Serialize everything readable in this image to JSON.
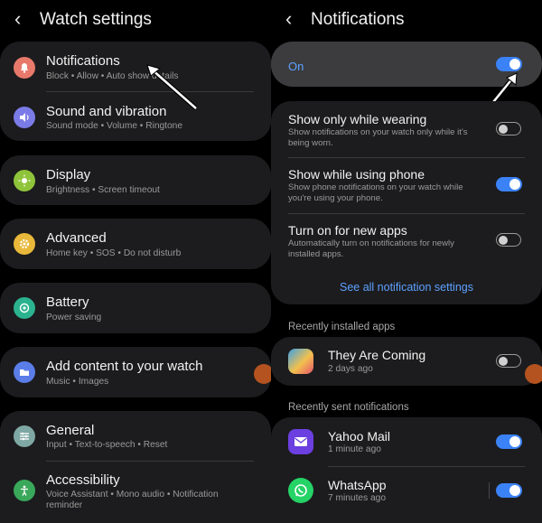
{
  "left": {
    "title": "Watch settings",
    "items": [
      {
        "title": "Notifications",
        "subtitle": "Block • Allow • Auto show details",
        "icon": "bell-icon",
        "color": "#e8796a"
      },
      {
        "title": "Sound and vibration",
        "subtitle": "Sound mode • Volume • Ringtone",
        "icon": "speaker-icon",
        "color": "#7b7be8"
      },
      {
        "title": "Display",
        "subtitle": "Brightness • Screen timeout",
        "icon": "brightness-icon",
        "color": "#8fc43a"
      },
      {
        "title": "Advanced",
        "subtitle": "Home key • SOS • Do not disturb",
        "icon": "gear-icon",
        "color": "#e8b83a"
      },
      {
        "title": "Battery",
        "subtitle": "Power saving",
        "icon": "battery-icon",
        "color": "#2bb38f"
      },
      {
        "title": "Add content to your watch",
        "subtitle": "Music • Images",
        "icon": "folder-icon",
        "color": "#5a7de8"
      },
      {
        "title": "General",
        "subtitle": "Input • Text-to-speech • Reset",
        "icon": "sliders-icon",
        "color": "#7fa8a4"
      },
      {
        "title": "Accessibility",
        "subtitle": "Voice Assistant • Mono audio • Notification reminder",
        "icon": "accessibility-icon",
        "color": "#3aa85a"
      }
    ]
  },
  "right": {
    "title": "Notifications",
    "master": {
      "label": "On",
      "state": "on"
    },
    "options": [
      {
        "title": "Show only while wearing",
        "subtitle": "Show notifications on your watch only while it's being worn.",
        "state": "off"
      },
      {
        "title": "Show while using phone",
        "subtitle": "Show phone notifications on your watch while you're using your phone.",
        "state": "on"
      },
      {
        "title": "Turn on for new apps",
        "subtitle": "Automatically turn on notifications for newly installed apps.",
        "state": "off"
      }
    ],
    "see_all": "See all notification settings",
    "recent_installed_label": "Recently installed apps",
    "installed_apps": [
      {
        "title": "They Are Coming",
        "subtitle": "2 days ago",
        "state": "off"
      }
    ],
    "recent_sent_label": "Recently sent notifications",
    "sent_apps": [
      {
        "title": "Yahoo Mail",
        "subtitle": "1 minute ago",
        "state": "on",
        "color": "#6b3fe0"
      },
      {
        "title": "WhatsApp",
        "subtitle": "7 minutes ago",
        "state": "on",
        "color": "#25d366"
      }
    ]
  },
  "colors": {
    "accent": "#3b82f6",
    "card": "#1c1c1e",
    "link": "#5ea1ff"
  }
}
